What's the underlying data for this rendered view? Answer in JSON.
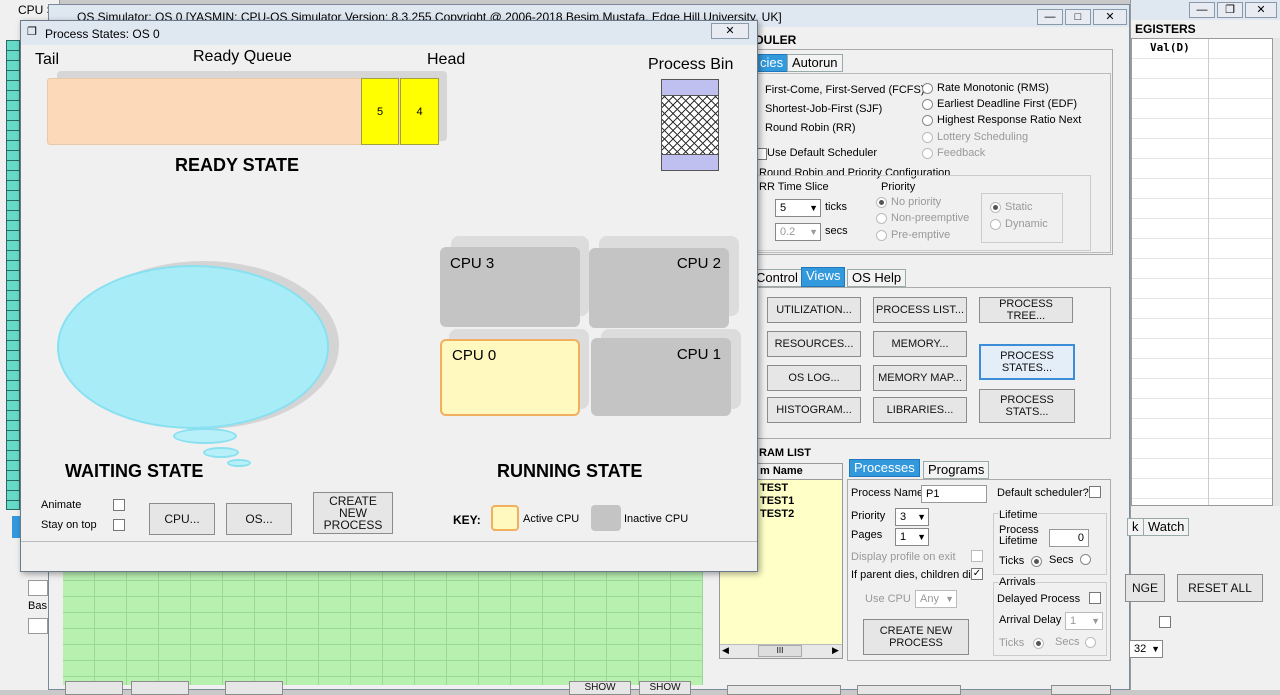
{
  "main_window": {
    "title": "OS Simulator: OS 0    [YASMIN: CPU-OS Simulator   Version: 8.3.255   Copyright @ 2006-2018 Besim Mustafa, Edge Hill University, UK]",
    "cpu_title": "CPU S"
  },
  "scheduler": {
    "heading": "DULER",
    "tabs": [
      "cies",
      "Autorun"
    ],
    "policies_left": [
      "First-Come, First-Served (FCFS)",
      "Shortest-Job-First (SJF)",
      "Round Robin (RR)"
    ],
    "policies_right": [
      "Rate Monotonic (RMS)",
      "Earliest Deadline First (EDF)",
      "Highest Response Ratio Next",
      "Lottery Scheduling",
      "Feedback"
    ],
    "use_default": "Use Default Scheduler",
    "rr_config_title": "Round Robin and Priority Configuration",
    "rr_time_slice": "RR Time Slice",
    "ticks_value": "5",
    "ticks_label": "ticks",
    "secs_value": "0.2",
    "secs_label": "secs",
    "priority_title": "Priority",
    "priority_options": [
      "No priority",
      "Non-preemptive",
      "Pre-emptive"
    ],
    "static_label": "Static",
    "dynamic_label": "Dynamic"
  },
  "views": {
    "tabs": [
      "Control",
      "Views",
      "OS Help"
    ],
    "buttons": [
      "UTILIZATION...",
      "PROCESS LIST...",
      "PROCESS TREE...",
      "RESOURCES...",
      "MEMORY...",
      "PROCESS STATES...",
      "OS LOG...",
      "MEMORY MAP...",
      "PROCESS STATS...",
      "HISTOGRAM...",
      "LIBRARIES..."
    ]
  },
  "program_list": {
    "title": "RAM LIST",
    "col_header": "m Name",
    "items": [
      "TEST",
      "TEST1",
      "TEST2"
    ],
    "tabs": [
      "Processes",
      "Programs"
    ],
    "process_name_label": "Process Name",
    "process_name_value": "P1",
    "default_scheduler_label": "Default scheduler?",
    "priority_label": "Priority",
    "priority_value": "3",
    "pages_label": "Pages",
    "pages_value": "1",
    "display_profile_label": "Display profile on exit",
    "parent_dies_label": "If parent dies, children die",
    "use_cpu_label": "Use CPU",
    "use_cpu_value": "Any",
    "create_btn": "CREATE NEW PROCESS",
    "lifetime_title": "Lifetime",
    "process_lifetime_label": "Process Lifetime",
    "lifetime_value": "0",
    "ticks_label": "Ticks",
    "secs_label": "Secs",
    "arrivals_title": "Arrivals",
    "delayed_label": "Delayed Process",
    "arrival_delay_label": "Arrival Delay",
    "arrival_delay_value": "1",
    "scroll_thumb": "III"
  },
  "registers": {
    "title": "EGISTERS",
    "col": "Val(D)"
  },
  "right_panel": {
    "tabs": [
      "k",
      "Watch"
    ],
    "change_btn": "NGE",
    "reset_btn": "RESET ALL",
    "select_value": "32"
  },
  "left_partial": {
    "base_label": "Bas",
    "bottom_buttons": [
      "SHOW",
      "SHOW"
    ]
  },
  "process_states": {
    "title": "Process States: OS 0",
    "tail": "Tail",
    "ready_queue": "Ready Queue",
    "head": "Head",
    "process_bin": "Process Bin",
    "queue_items": [
      "5",
      "4"
    ],
    "ready_state": "READY STATE",
    "waiting_state": "WAITING STATE",
    "running_state": "RUNNING STATE",
    "cpus": [
      "CPU 3",
      "CPU 2",
      "CPU 0",
      "CPU 1"
    ],
    "animate": "Animate",
    "stay_on_top": "Stay on top",
    "cpu_btn": "CPU...",
    "os_btn": "OS...",
    "create_btn": "CREATE NEW PROCESS",
    "key_label": "KEY:",
    "active_cpu": "Active CPU",
    "inactive_cpu": "Inactive CPU"
  },
  "colors": {
    "queue_fill": "#fcd9b8",
    "queue_item": "#ffff00",
    "active_cpu": "#fff9c0",
    "active_cpu_border": "#f0b060",
    "inactive_cpu": "#c4c4c4",
    "waiting_fill": "#a8ecf8",
    "tab_selected": "#3399dd"
  }
}
